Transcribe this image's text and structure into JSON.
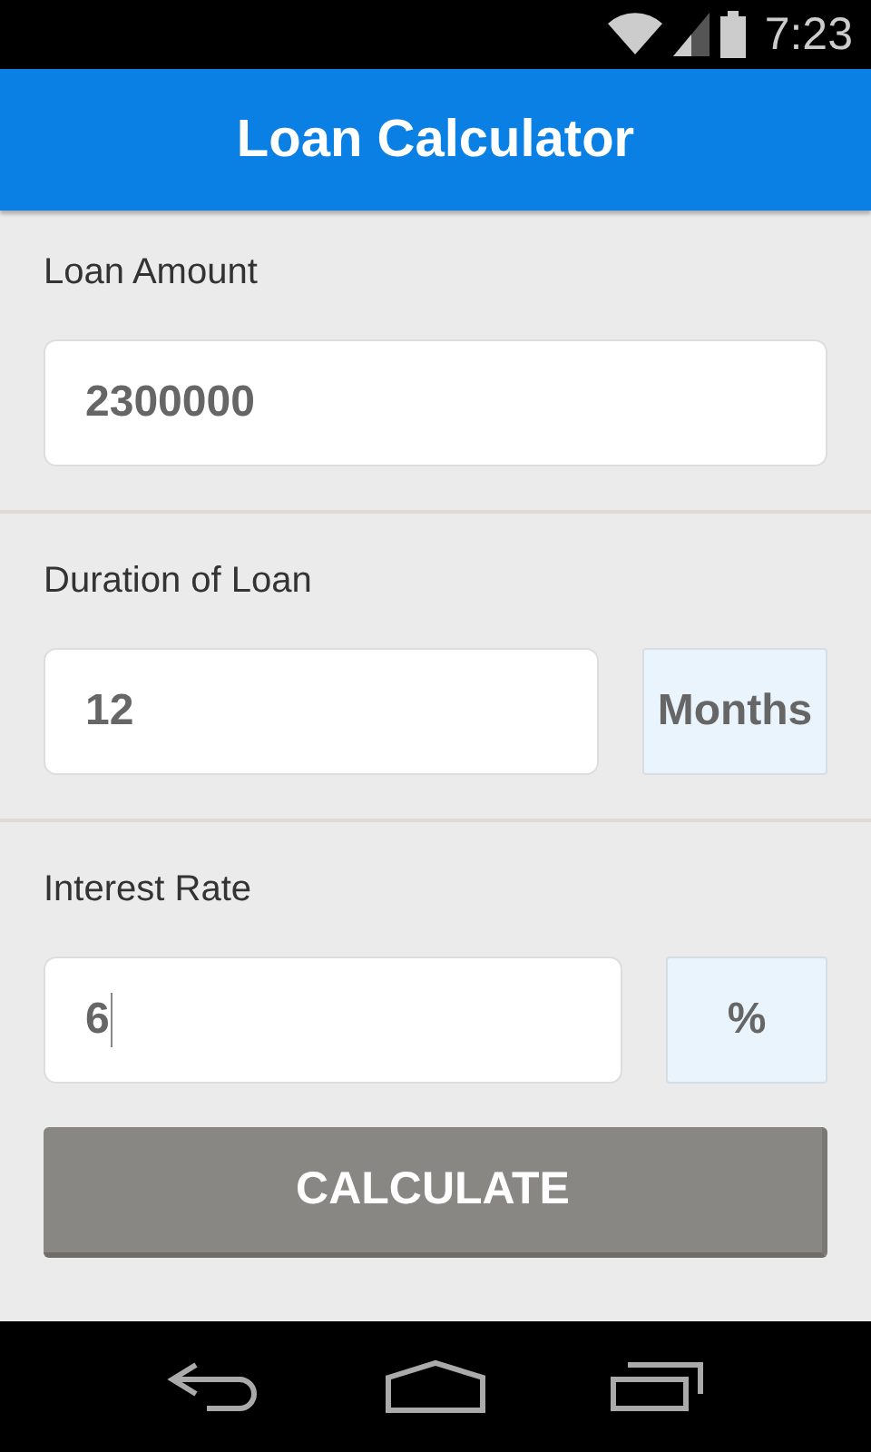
{
  "status_bar": {
    "time": "7:23"
  },
  "app_bar": {
    "title": "Loan Calculator"
  },
  "fields": [
    {
      "label": "Loan Amount",
      "value": "2300000",
      "focused": false
    },
    {
      "label": "Duration of Loan",
      "value": "12",
      "unit": "Months",
      "focused": false
    },
    {
      "label": "Interest Rate",
      "value": "6",
      "unit": "%",
      "focused": true
    }
  ],
  "button": {
    "label": "CALCULATE"
  }
}
